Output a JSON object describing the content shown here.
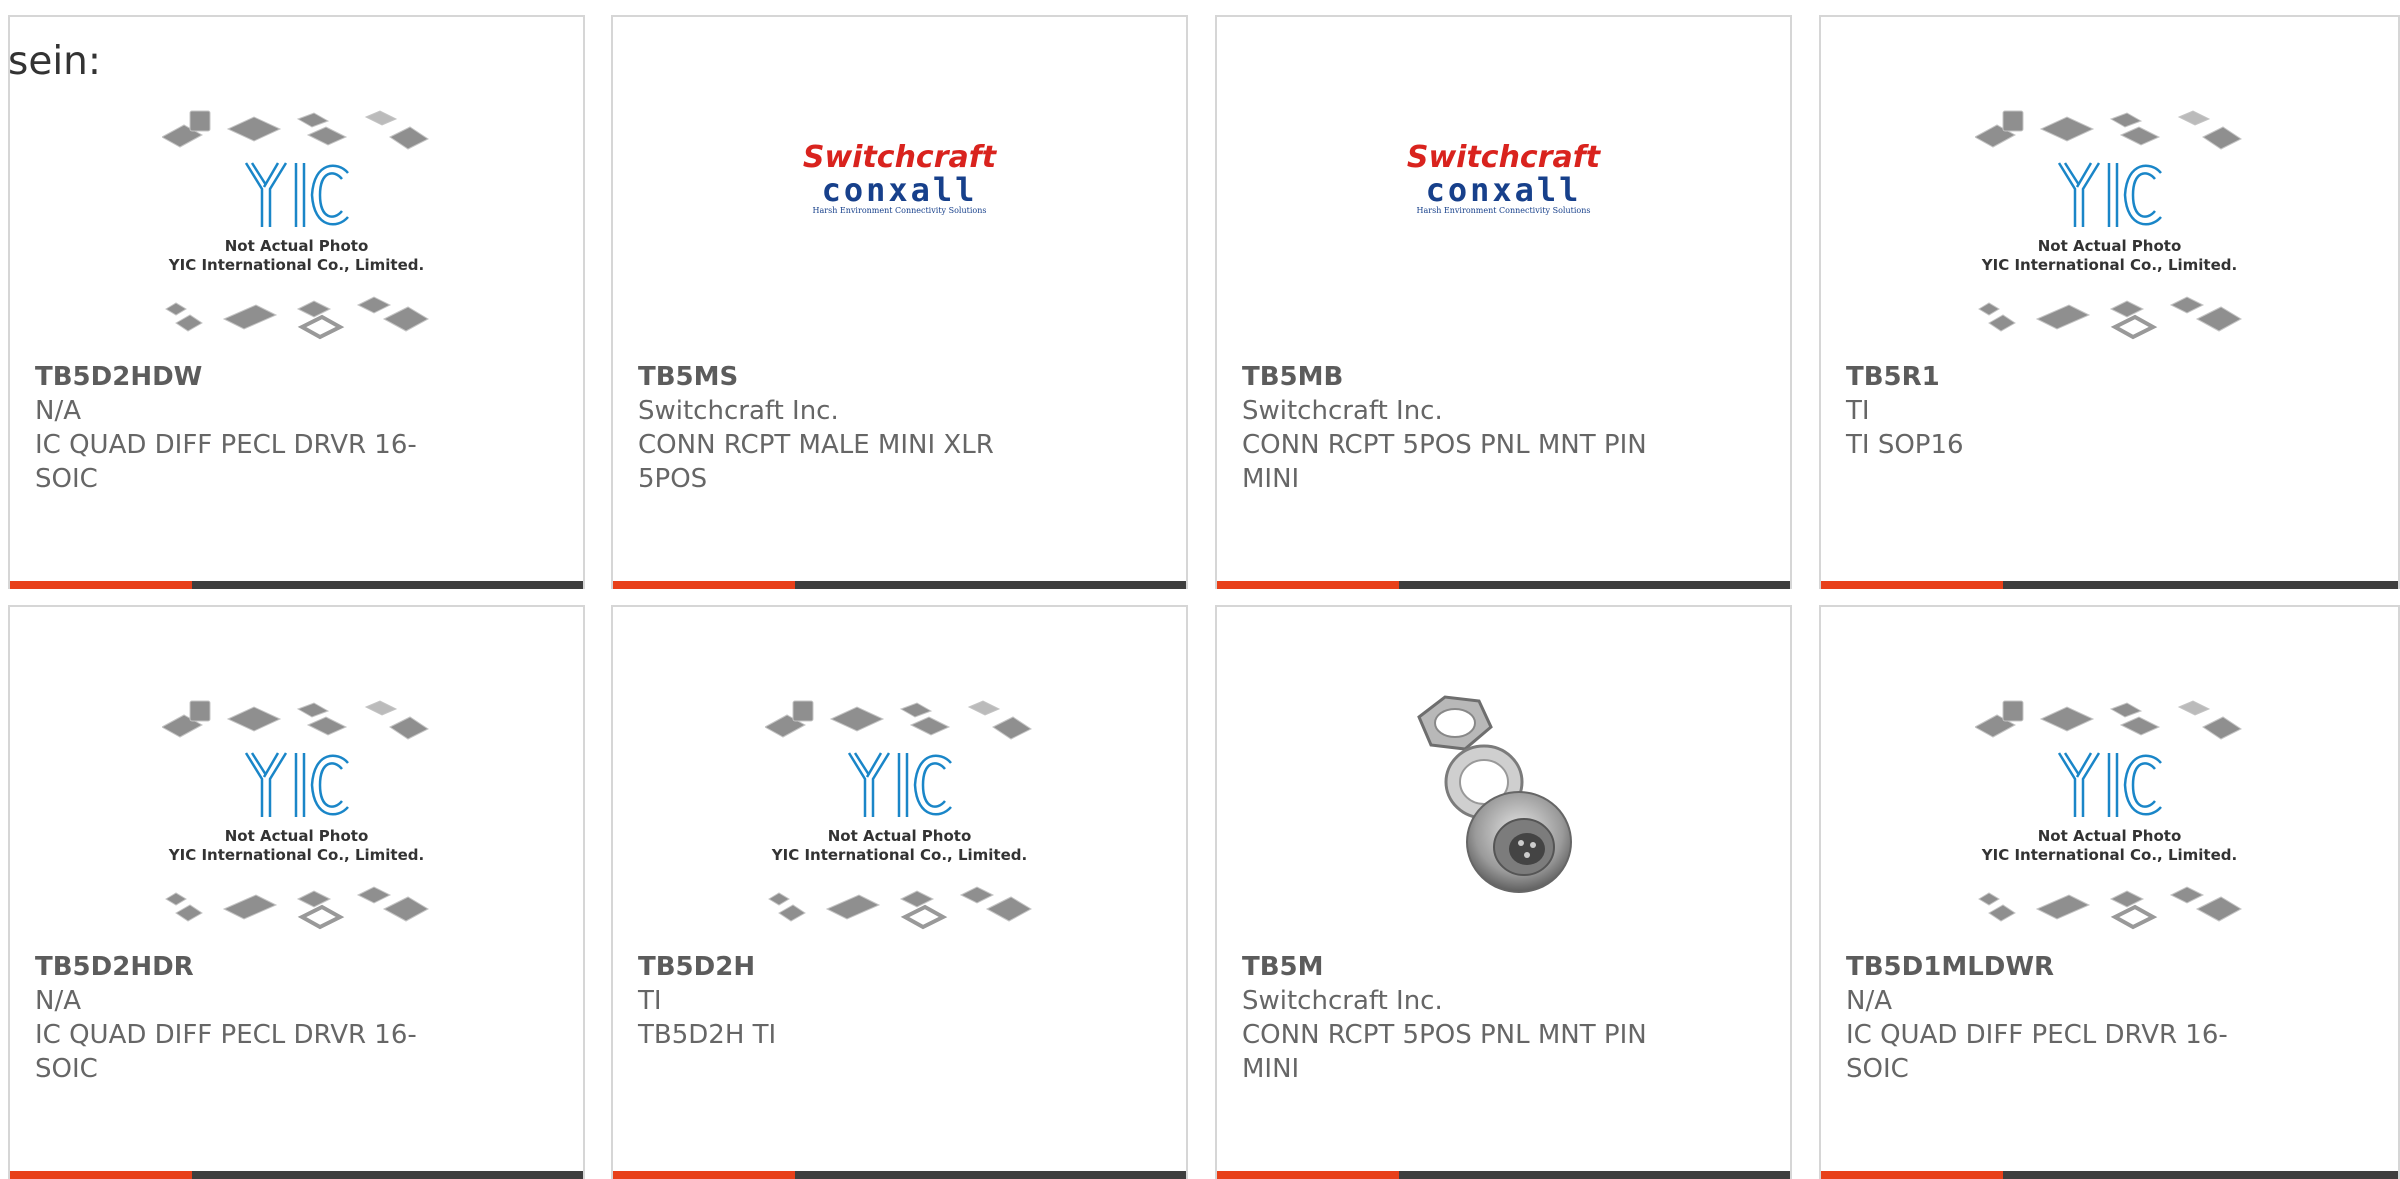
{
  "intro_text": "sein:",
  "placeholder": {
    "line1": "Not Actual Photo",
    "line2": "YIC International Co., Limited."
  },
  "brand_logo": {
    "line1": "Switchcraft",
    "line2": "conxall",
    "line3": "Harsh Environment Connectivity Solutions"
  },
  "colors": {
    "accent": "#e8401a",
    "bar": "#3e3e3e",
    "card_border": "#d6d6d6",
    "text": "#666666",
    "yic_blue": "#1a86c8",
    "switchcraft_red": "#d9231e",
    "conxall_blue": "#17408b"
  },
  "products": [
    {
      "part_number": "TB5D2HDW",
      "manufacturer": "N/A",
      "description": "IC QUAD DIFF PECL DRVR 16-SOIC",
      "image": "yic-placeholder"
    },
    {
      "part_number": "TB5MS",
      "manufacturer": "Switchcraft Inc.",
      "description": "CONN RCPT MALE MINI XLR 5POS",
      "image": "switchcraft-logo"
    },
    {
      "part_number": "TB5MB",
      "manufacturer": "Switchcraft Inc.",
      "description": "CONN RCPT 5POS PNL MNT PIN MINI",
      "image": "switchcraft-logo"
    },
    {
      "part_number": "TB5R1",
      "manufacturer": "TI",
      "description": "TI SOP16",
      "image": "yic-placeholder"
    },
    {
      "part_number": "TB5D2HDR",
      "manufacturer": "N/A",
      "description": "IC QUAD DIFF PECL DRVR 16-SOIC",
      "image": "yic-placeholder"
    },
    {
      "part_number": "TB5D2H",
      "manufacturer": "TI",
      "description": "TB5D2H TI",
      "image": "yic-placeholder"
    },
    {
      "part_number": "TB5M",
      "manufacturer": "Switchcraft Inc.",
      "description": "CONN RCPT 5POS PNL MNT PIN MINI",
      "image": "connector-photo"
    },
    {
      "part_number": "TB5D1MLDWR",
      "manufacturer": "N/A",
      "description": "IC QUAD DIFF PECL DRVR 16-SOIC",
      "image": "yic-placeholder"
    }
  ]
}
